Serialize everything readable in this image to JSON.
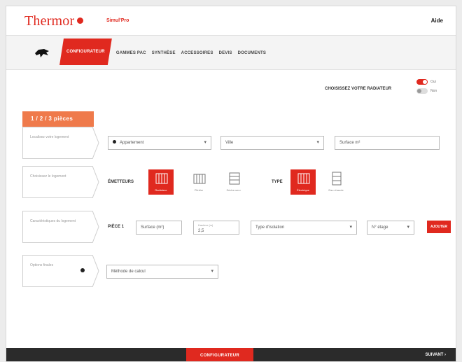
{
  "header": {
    "logo_text": "Thermor",
    "subbrand": "Simul'Pro",
    "user": "Aide"
  },
  "nav": {
    "icon": "animal-logo-icon",
    "tabs": [
      {
        "label": "CONFIGURATEUR",
        "active": true
      },
      {
        "label": "GAMMES PAC"
      },
      {
        "label": "SYNTHÈSE"
      },
      {
        "label": "ACCESSOIRES"
      },
      {
        "label": "DEVIS"
      },
      {
        "label": "DOCUMENTS"
      }
    ]
  },
  "recommendation": {
    "label": "CHOISISSEZ VOTRE RADIATEUR",
    "option_on": "Oui",
    "option_off": "Non"
  },
  "quote": {
    "tab_label": "1 / 2 / 3 pièces"
  },
  "steps": {
    "s1": {
      "label": "Localisez votre logement",
      "type_value": "Appartement",
      "city_value": "Ville",
      "extra_value": "Surface m²"
    },
    "s2": {
      "label": "Choisissez le logement",
      "emission_label": "ÉMETTEURS",
      "emission_tiles": [
        "Radiateur",
        "Plinthe",
        "Sèche-serv."
      ],
      "type_label": "TYPE",
      "type_tiles": [
        "Électrique",
        "Eau chaude"
      ]
    },
    "s3": {
      "label": "Caractéristiques du logement",
      "room_label": "PIÈCE 1",
      "field_a": "Surface (m²)",
      "field_b_top": "Hauteur (m)",
      "field_b_value": "2,5",
      "field_c": "Type d'isolation",
      "field_d": "N° étage",
      "add_button": "AJOUTER"
    },
    "s4": {
      "label": "Options finales",
      "select_value": "Méthode de calcul"
    }
  },
  "footer": {
    "primary_button": "CONFIGURATEUR",
    "next_link": "SUIVANT"
  },
  "colors": {
    "brand_red": "#e0291f",
    "accent_orange": "#ef7a4b",
    "footer_bg": "#2b2b2b"
  }
}
